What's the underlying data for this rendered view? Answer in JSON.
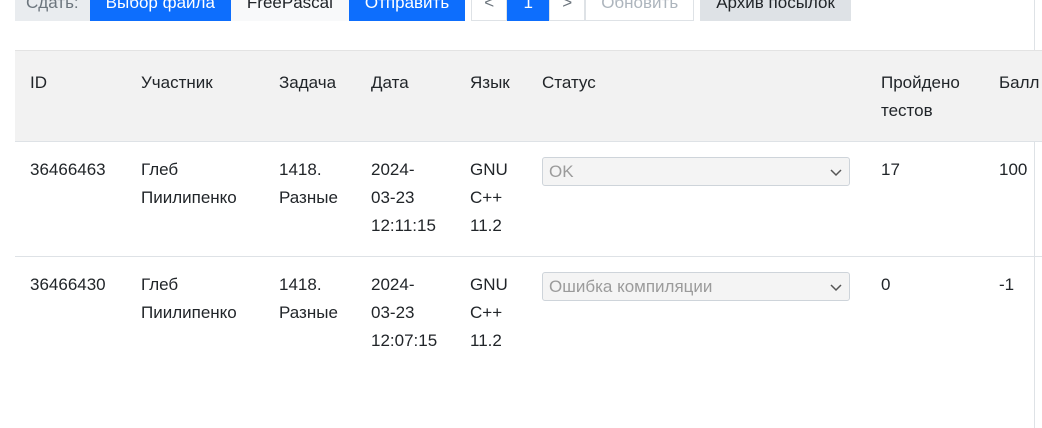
{
  "toolbar": {
    "submit_label": "Сдать:",
    "choose_file": "Выбор файла",
    "language": "FreePascal",
    "send": "Отправить",
    "prev": "<",
    "page": "1",
    "next": ">",
    "refresh": "Обновить",
    "archive": "Архив посылок"
  },
  "table": {
    "headers": {
      "id": "ID",
      "participant": "Участник",
      "task": "Задача",
      "date": "Дата",
      "lang": "Язык",
      "status": "Статус",
      "passed_l1": "Пройдено",
      "passed_l2": "тестов",
      "score": "Балл"
    },
    "rows": [
      {
        "id": "36466463",
        "participant_l1": "Глеб",
        "participant_l2": "Пиилипенко",
        "task_l1": "1418.",
        "task_l2": "Разные",
        "date_l1": "2024-",
        "date_l2": "03-23",
        "date_l3": "12:11:15",
        "lang_l1": "GNU",
        "lang_l2": "C++",
        "lang_l3": "11.2",
        "status": "OK",
        "passed": "17",
        "score": "100"
      },
      {
        "id": "36466430",
        "participant_l1": "Глеб",
        "participant_l2": "Пиилипенко",
        "task_l1": "1418.",
        "task_l2": "Разные",
        "date_l1": "2024-",
        "date_l2": "03-23",
        "date_l3": "12:07:15",
        "lang_l1": "GNU",
        "lang_l2": "C++",
        "lang_l3": "11.2",
        "status": "Ошибка компиляции",
        "passed": "0",
        "score": "-1"
      }
    ]
  }
}
